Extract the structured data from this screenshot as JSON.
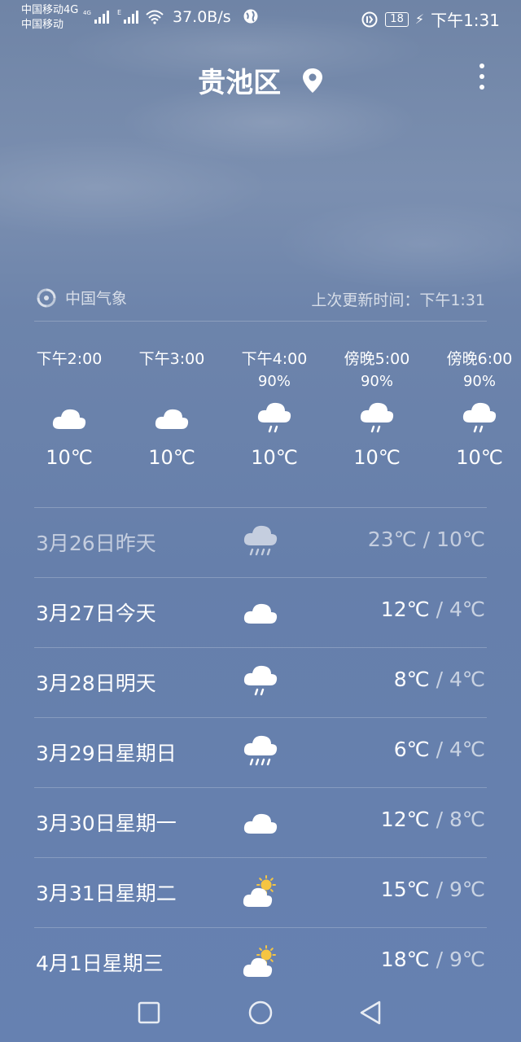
{
  "status_bar": {
    "carrier1": "中国移动4G",
    "carrier2": "中国移动",
    "net1": "4G",
    "net2": "E",
    "speed": "37.0B/s",
    "battery": "18",
    "time": "下午1:31"
  },
  "header": {
    "city": "贵池区",
    "location_icon": "location-pin-icon",
    "menu_icon": "more-vertical-icon"
  },
  "source": {
    "name": "中国气象",
    "icon": "cma-logo-icon",
    "updated": "上次更新时间：下午1:31"
  },
  "hourly": [
    {
      "time": "下午2:00",
      "precip": "",
      "icon": "cloud",
      "temp": "10℃"
    },
    {
      "time": "下午3:00",
      "precip": "",
      "icon": "cloud",
      "temp": "10℃"
    },
    {
      "time": "下午4:00",
      "precip": "90%",
      "icon": "light-rain",
      "temp": "10℃"
    },
    {
      "time": "傍晚5:00",
      "precip": "90%",
      "icon": "light-rain",
      "temp": "10℃"
    },
    {
      "time": "傍晚6:00",
      "precip": "90%",
      "icon": "light-rain",
      "temp": "10℃"
    }
  ],
  "daily": [
    {
      "date": "3月26日昨天",
      "icon": "heavy-rain",
      "high": "23℃",
      "sep": " / ",
      "low": "10℃"
    },
    {
      "date": "3月27日今天",
      "icon": "cloud",
      "high": "12℃",
      "sep": " / ",
      "low": "4℃"
    },
    {
      "date": "3月28日明天",
      "icon": "light-rain",
      "high": "8℃",
      "sep": " / ",
      "low": "4℃"
    },
    {
      "date": "3月29日星期日",
      "icon": "heavy-rain",
      "high": "6℃",
      "sep": " / ",
      "low": "4℃"
    },
    {
      "date": "3月30日星期一",
      "icon": "cloud",
      "high": "12℃",
      "sep": " / ",
      "low": "8℃"
    },
    {
      "date": "3月31日星期二",
      "icon": "partly-sunny",
      "high": "15℃",
      "sep": " / ",
      "low": "9℃"
    },
    {
      "date": "4月1日星期三",
      "icon": "partly-sunny",
      "high": "18℃",
      "sep": " / ",
      "low": "9℃"
    }
  ],
  "nav": {
    "recents_icon": "square-icon",
    "home_icon": "circle-icon",
    "back_icon": "triangle-back-icon"
  },
  "colors": {
    "background": "#6681b1",
    "sun": "#f5c542"
  }
}
